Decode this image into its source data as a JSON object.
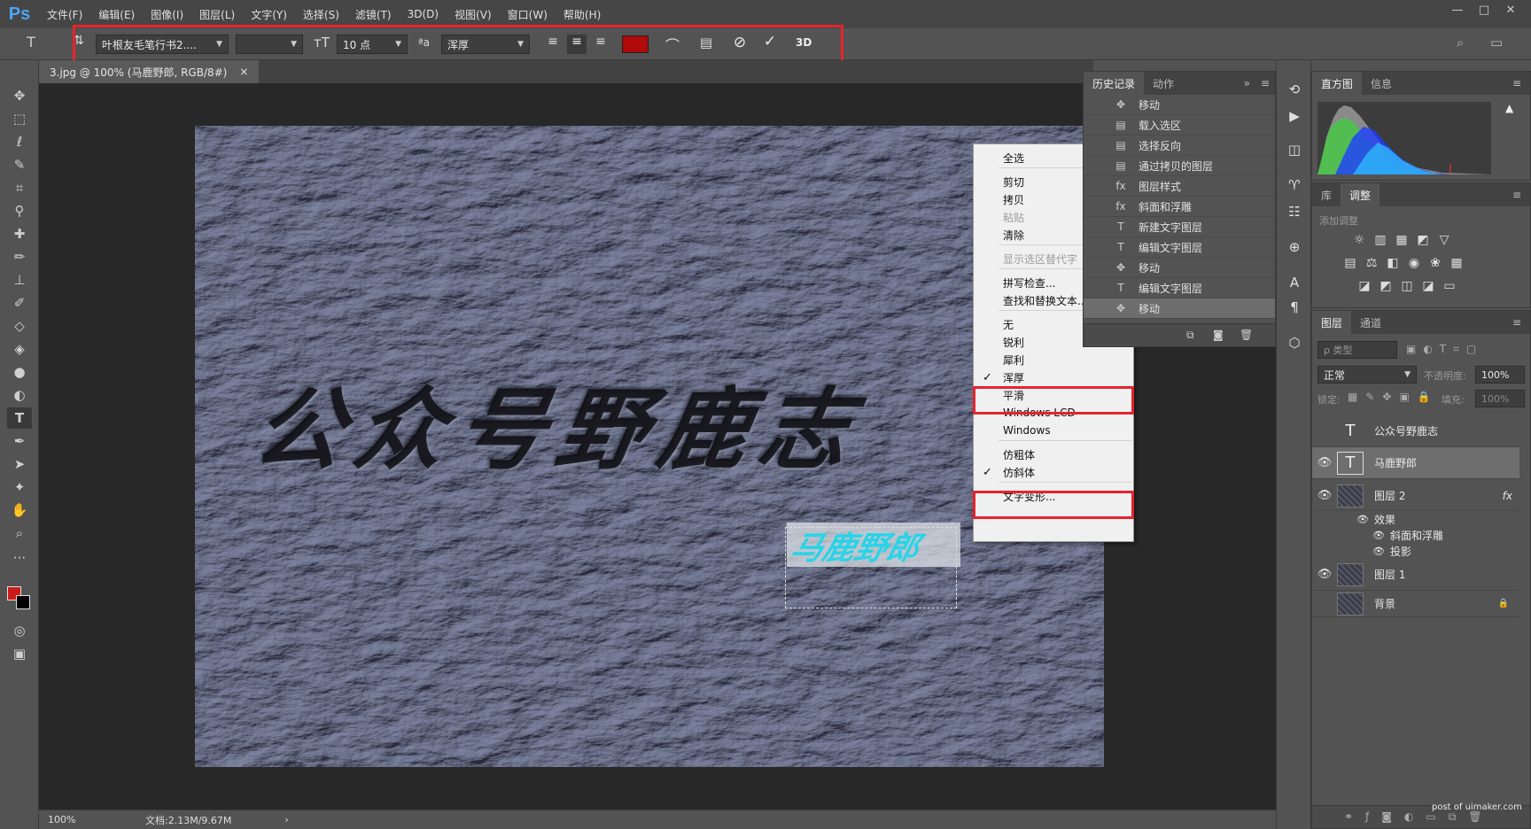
{
  "app": {
    "logo": "Ps",
    "window_controls": [
      "—",
      "□",
      "✕"
    ]
  },
  "menu": [
    "文件(F)",
    "编辑(E)",
    "图像(I)",
    "图层(L)",
    "文字(Y)",
    "选择(S)",
    "滤镜(T)",
    "3D(D)",
    "视图(V)",
    "窗口(W)",
    "帮助(H)"
  ],
  "options": {
    "font_family": "叶根友毛笔行书2....",
    "font_size": "10 点",
    "aa_label": "ªa",
    "aa_method": "浑厚",
    "text_color": "#b00a0a",
    "label_3d": "3D"
  },
  "document": {
    "tab_title": "3.jpg @ 100% (马鹿野郎, RGB/8#)",
    "tab_close": "×",
    "zoom": "100%",
    "file_info": "文档:2.13M/9.67M",
    "status_arrow": "›",
    "canvas_text": "公众号野鹿志",
    "selected_text": "马鹿野郎"
  },
  "history": {
    "tabs": [
      "历史记录",
      "动作"
    ],
    "items": [
      "移动",
      "载入选区",
      "选择反向",
      "通过拷贝的图层",
      "图层样式",
      "斜面和浮雕",
      "新建文字图层",
      "编辑文字图层",
      "移动",
      "编辑文字图层",
      "移动"
    ]
  },
  "context_menu": {
    "items": [
      "全选",
      "剪切",
      "拷贝",
      "粘贴",
      "清除",
      "显示选区替代字",
      "拼写检查...",
      "查找和替换文本...",
      "无",
      "锐利",
      "犀利",
      "浑厚",
      "平滑",
      "Windows LCD",
      "Windows",
      "仿粗体",
      "仿斜体",
      "文字变形..."
    ],
    "checked": [
      "浑厚",
      "仿斜体"
    ],
    "disabled": [
      "粘贴",
      "显示选区替代字"
    ]
  },
  "histogram": {
    "tabs": [
      "直方图",
      "信息"
    ],
    "warning": "▲"
  },
  "adjustments": {
    "tabs": [
      "库",
      "调整"
    ],
    "add_label": "添加调整"
  },
  "layers": {
    "tabs": [
      "图层",
      "通道"
    ],
    "kind_filter": "ρ 类型",
    "blend_mode": "正常",
    "opacity_label": "不透明度:",
    "opacity": "100%",
    "lock_label": "锁定:",
    "fill_label": "填充:",
    "fill": "100%",
    "items": [
      {
        "name": "公众号野鹿志",
        "kind": "text",
        "visible": false
      },
      {
        "name": "马鹿野郎",
        "kind": "text",
        "visible": true,
        "selected": true
      },
      {
        "name": "图层 2",
        "kind": "image",
        "visible": true,
        "fx": "fx"
      },
      {
        "name": "效果",
        "kind": "effect-group"
      },
      {
        "name": "斜面和浮雕",
        "kind": "effect"
      },
      {
        "name": "投影",
        "kind": "effect"
      },
      {
        "name": "图层 1",
        "kind": "image",
        "visible": true
      },
      {
        "name": "背景",
        "kind": "image",
        "visible": false,
        "locked": true
      }
    ]
  },
  "watermark": "post of uimaker.com",
  "colors": {
    "highlight": "#e8222e",
    "foreground": "#cc1a1a",
    "selected_text_fill": "#27d4e8"
  }
}
